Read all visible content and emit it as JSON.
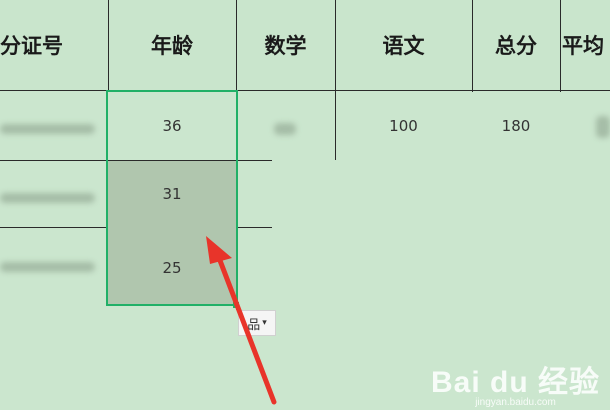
{
  "columns": [
    "分证号",
    "年龄",
    "数学",
    "语文",
    "总分",
    "平均"
  ],
  "rows": [
    {
      "id": "",
      "age": "36",
      "math": "",
      "chinese": "100",
      "total": "180"
    },
    {
      "id": "",
      "age": "31",
      "math": "",
      "chinese": "",
      "total": ""
    },
    {
      "id": "",
      "age": "25",
      "math": "",
      "chinese": "",
      "total": ""
    }
  ],
  "paste_options_label": "品",
  "paste_options_arrow": "▾",
  "watermark": {
    "logo": "Bai du 经验",
    "url": "jingyan.baidu.com"
  },
  "colors": {
    "selection_border": "#21b067",
    "selection_fill": "#b0c6ae",
    "arrow": "#e8342a"
  }
}
